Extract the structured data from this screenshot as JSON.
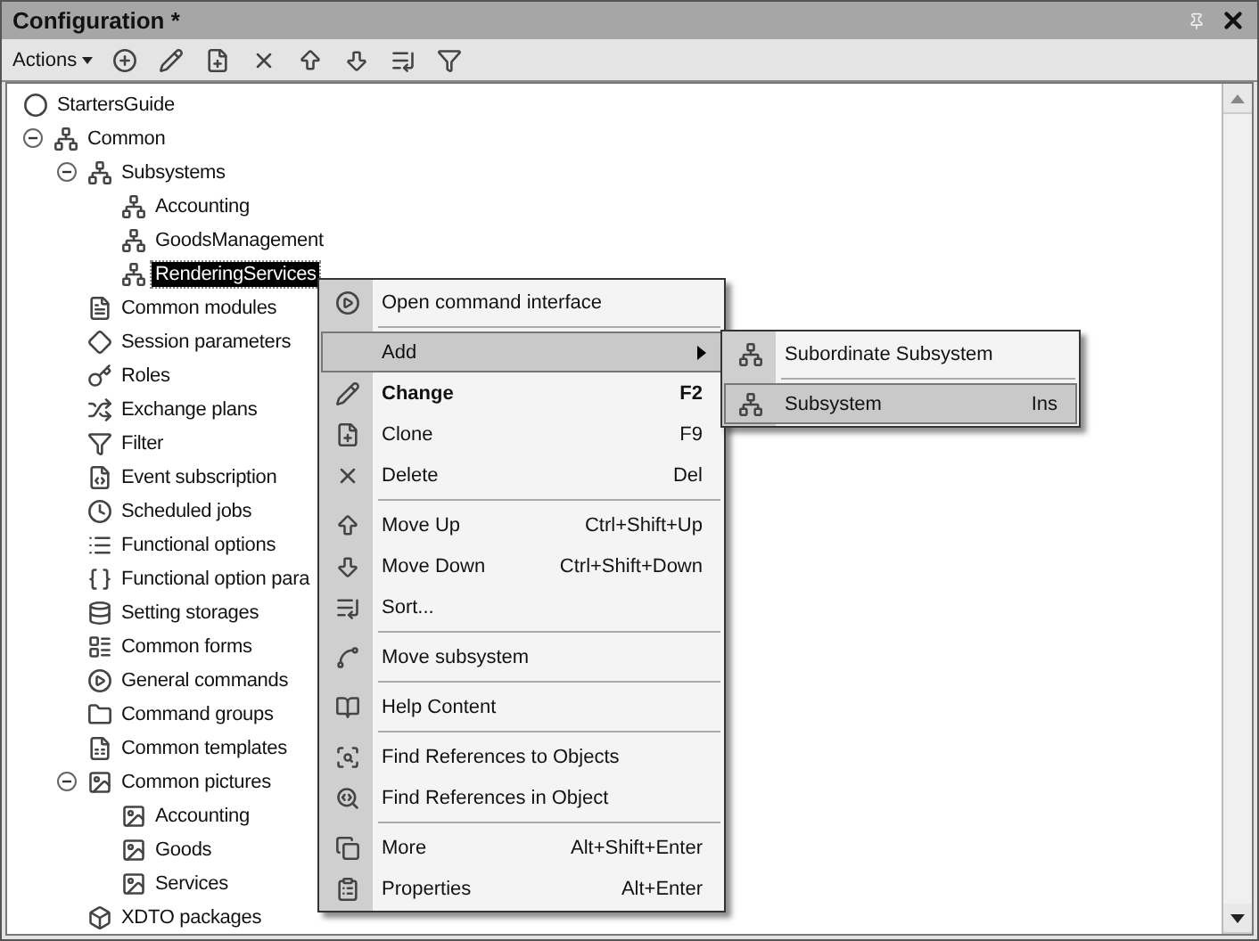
{
  "window": {
    "title": "Configuration *"
  },
  "toolbar": {
    "actions_label": "Actions"
  },
  "tree": [
    {
      "label": "StartersGuide",
      "selected": false
    },
    {
      "label": "Common",
      "selected": false,
      "expanded": true,
      "children": [
        {
          "label": "Subsystems",
          "selected": false,
          "expanded": true,
          "children": [
            {
              "label": "Accounting",
              "selected": false
            },
            {
              "label": "GoodsManagement",
              "selected": false
            },
            {
              "label": "RenderingServices",
              "selected": true
            }
          ]
        },
        {
          "label": "Common modules",
          "selected": false
        },
        {
          "label": "Session parameters",
          "selected": false
        },
        {
          "label": "Roles",
          "selected": false
        },
        {
          "label": "Exchange plans",
          "selected": false
        },
        {
          "label": "Filter",
          "selected": false
        },
        {
          "label": "Event subscription",
          "selected": false
        },
        {
          "label": "Scheduled jobs",
          "selected": false
        },
        {
          "label": "Functional options",
          "selected": false
        },
        {
          "label": "Functional option para",
          "selected": false
        },
        {
          "label": "Setting storages",
          "selected": false
        },
        {
          "label": "Common forms",
          "selected": false
        },
        {
          "label": "General commands",
          "selected": false
        },
        {
          "label": "Command groups",
          "selected": false
        },
        {
          "label": "Common templates",
          "selected": false
        },
        {
          "label": "Common pictures",
          "selected": false,
          "expanded": true,
          "children": [
            {
              "label": "Accounting",
              "selected": false
            },
            {
              "label": "Goods",
              "selected": false
            },
            {
              "label": "Services",
              "selected": false
            }
          ]
        },
        {
          "label": "XDTO packages",
          "selected": false
        }
      ]
    }
  ],
  "context_menu": {
    "items": [
      {
        "kind": "item",
        "label": "Open command interface",
        "selected": false,
        "default": false,
        "has_submenu": false
      },
      {
        "kind": "separator"
      },
      {
        "kind": "item",
        "label": "Add",
        "selected": true,
        "default": false,
        "has_submenu": true
      },
      {
        "kind": "item",
        "label": "Change",
        "shortcut": "F2",
        "selected": false,
        "default": true,
        "has_submenu": false
      },
      {
        "kind": "item",
        "label": "Clone",
        "shortcut": "F9",
        "selected": false,
        "default": false,
        "has_submenu": false
      },
      {
        "kind": "item",
        "label": "Delete",
        "shortcut": "Del",
        "selected": false,
        "default": false,
        "has_submenu": false
      },
      {
        "kind": "separator"
      },
      {
        "kind": "item",
        "label": "Move Up",
        "shortcut": "Ctrl+Shift+Up",
        "selected": false,
        "default": false,
        "has_submenu": false
      },
      {
        "kind": "item",
        "label": "Move Down",
        "shortcut": "Ctrl+Shift+Down",
        "selected": false,
        "default": false,
        "has_submenu": false
      },
      {
        "kind": "item",
        "label": "Sort...",
        "selected": false,
        "default": false,
        "has_submenu": false
      },
      {
        "kind": "separator"
      },
      {
        "kind": "item",
        "label": "Move subsystem",
        "selected": false,
        "default": false,
        "has_submenu": false
      },
      {
        "kind": "separator"
      },
      {
        "kind": "item",
        "label": "Help Content",
        "selected": false,
        "default": false,
        "has_submenu": false
      },
      {
        "kind": "separator"
      },
      {
        "kind": "item",
        "label": "Find References to Objects",
        "selected": false,
        "default": false,
        "has_submenu": false
      },
      {
        "kind": "item",
        "label": "Find References in Object",
        "selected": false,
        "default": false,
        "has_submenu": false
      },
      {
        "kind": "separator"
      },
      {
        "kind": "item",
        "label": "More",
        "shortcut": "Alt+Shift+Enter",
        "selected": false,
        "default": false,
        "has_submenu": false
      },
      {
        "kind": "item",
        "label": "Properties",
        "shortcut": "Alt+Enter",
        "selected": false,
        "default": false,
        "has_submenu": false
      }
    ]
  },
  "submenu": {
    "items": [
      {
        "kind": "item",
        "label": "Subordinate Subsystem",
        "selected": false
      },
      {
        "kind": "separator"
      },
      {
        "kind": "item",
        "label": "Subsystem",
        "shortcut": "Ins",
        "selected": true
      }
    ]
  }
}
